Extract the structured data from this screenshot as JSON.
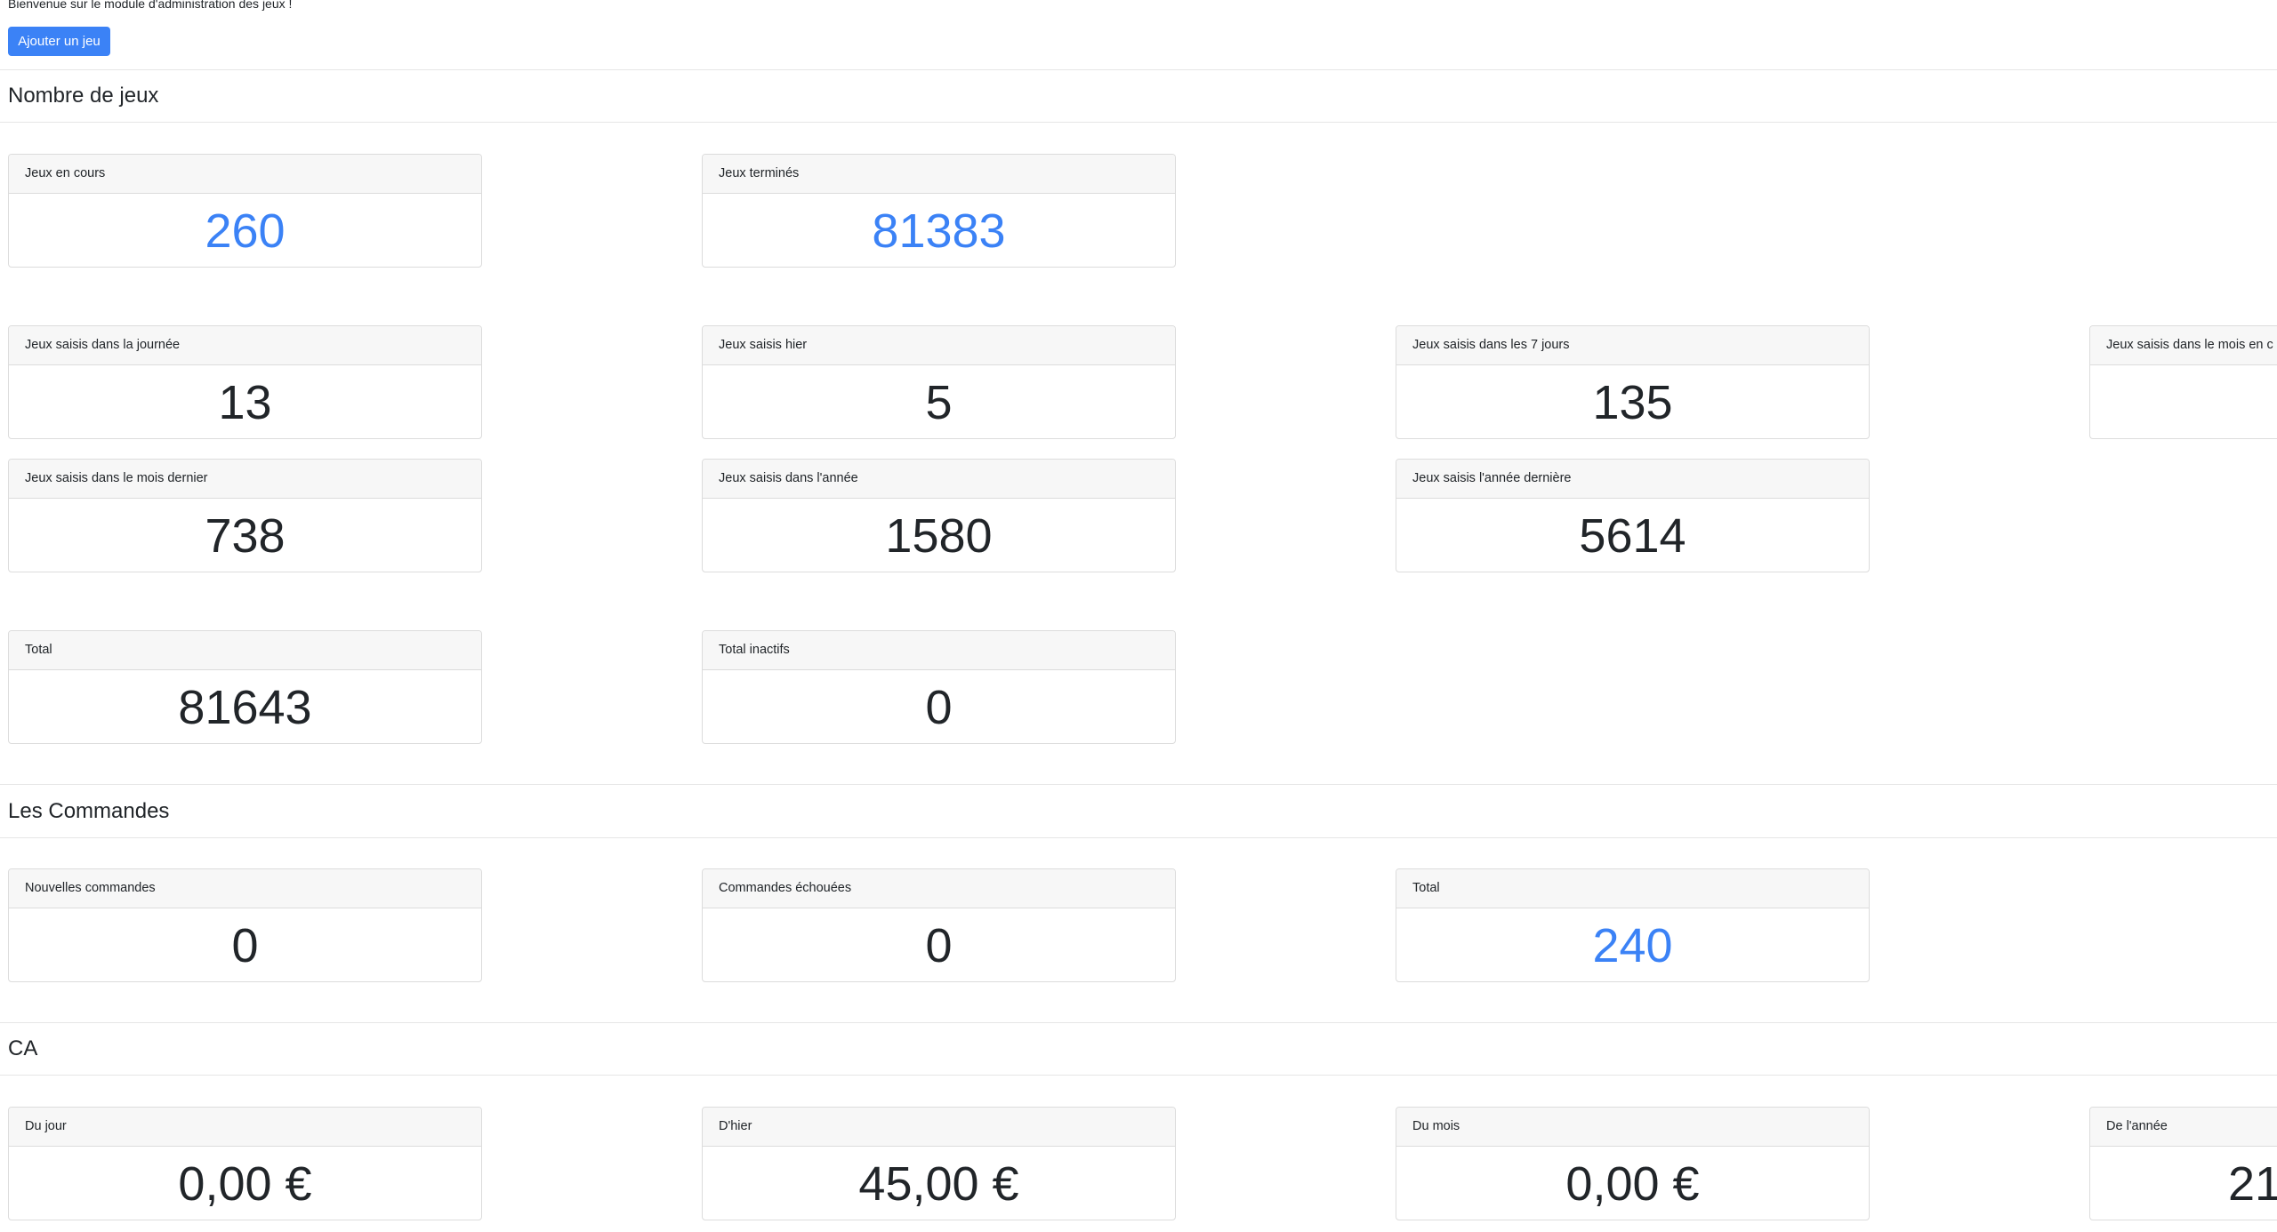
{
  "welcome_text": "Bienvenue sur le module d'administration des jeux !",
  "add_game_button": "Ajouter un jeu",
  "sections": {
    "games": {
      "title": "Nombre de jeux",
      "in_progress": {
        "label": "Jeux en cours",
        "value": "260"
      },
      "finished": {
        "label": "Jeux terminés",
        "value": "81383"
      },
      "today": {
        "label": "Jeux saisis dans la journée",
        "value": "13"
      },
      "yesterday": {
        "label": "Jeux saisis hier",
        "value": "5"
      },
      "last7": {
        "label": "Jeux saisis dans les 7 jours",
        "value": "135"
      },
      "current_month": {
        "label": "Jeux saisis dans le mois en c",
        "value": ""
      },
      "last_month": {
        "label": "Jeux saisis dans le mois dernier",
        "value": "738"
      },
      "this_year": {
        "label": "Jeux saisis dans l'année",
        "value": "1580"
      },
      "last_year": {
        "label": "Jeux saisis l'année dernière",
        "value": "5614"
      },
      "total": {
        "label": "Total",
        "value": "81643"
      },
      "total_inactive": {
        "label": "Total inactifs",
        "value": "0"
      }
    },
    "orders": {
      "title": "Les Commandes",
      "new": {
        "label": "Nouvelles commandes",
        "value": "0"
      },
      "failed": {
        "label": "Commandes échouées",
        "value": "0"
      },
      "total": {
        "label": "Total",
        "value": "240"
      }
    },
    "revenue": {
      "title": "CA",
      "day": {
        "label": "Du jour",
        "value": "0,00 €"
      },
      "yesterday": {
        "label": "D'hier",
        "value": "45,00 €"
      },
      "month": {
        "label": "Du mois",
        "value": "0,00 €"
      },
      "year": {
        "label": "De l'année",
        "value": "21"
      }
    }
  },
  "colors": {
    "accent": "#3b82f6",
    "card_header_bg": "#f7f7f7",
    "border": "#dcdcdc"
  }
}
